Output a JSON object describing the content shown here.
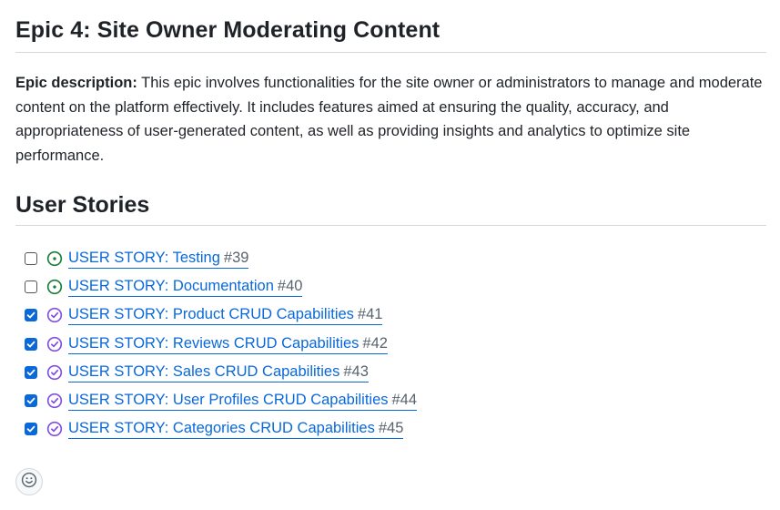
{
  "epic": {
    "title": "Epic 4: Site Owner Moderating Content",
    "description_label": "Epic description:",
    "description_text": " This epic involves functionalities for the site owner or administrators to manage and moderate content on the platform effectively. It includes features aimed at ensuring the quality, accuracy, and appropriateness of user-generated content, as well as providing insights and analytics to optimize site performance."
  },
  "user_stories": {
    "heading": "User Stories",
    "items": [
      {
        "title": "USER STORY: Testing",
        "number": "#39",
        "checked": false,
        "status": "open"
      },
      {
        "title": "USER STORY: Documentation",
        "number": "#40",
        "checked": false,
        "status": "open"
      },
      {
        "title": "USER STORY: Product CRUD Capabilities",
        "number": "#41",
        "checked": true,
        "status": "closed"
      },
      {
        "title": "USER STORY: Reviews CRUD Capabilities",
        "number": "#42",
        "checked": true,
        "status": "closed"
      },
      {
        "title": "USER STORY: Sales CRUD Capabilities",
        "number": "#43",
        "checked": true,
        "status": "closed"
      },
      {
        "title": "USER STORY: User Profiles CRUD Capabilities",
        "number": "#44",
        "checked": true,
        "status": "closed"
      },
      {
        "title": "USER STORY: Categories CRUD Capabilities",
        "number": "#45",
        "checked": true,
        "status": "closed"
      }
    ]
  },
  "reaction": {
    "icon": "smiley-icon"
  },
  "colors": {
    "link": "#0969da",
    "open_status": "#1a7f37",
    "closed_status": "#8250df",
    "checkbox_checked": "#0969da"
  }
}
